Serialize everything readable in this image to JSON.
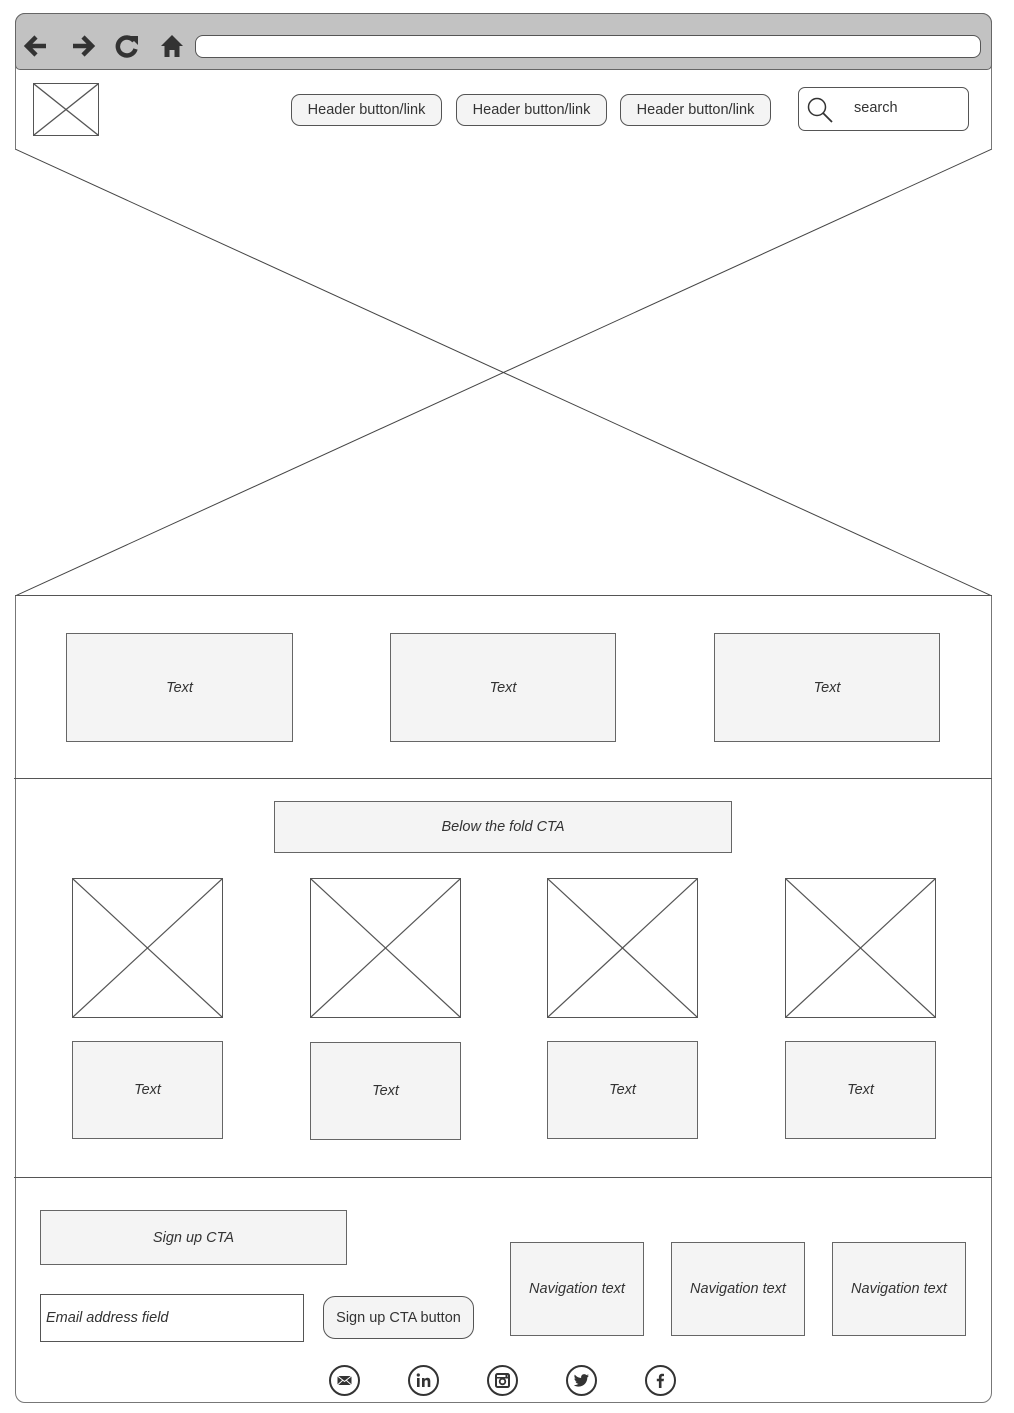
{
  "browser": {
    "nav_icons": [
      "back-arrow-icon",
      "forward-arrow-icon",
      "reload-icon",
      "home-icon"
    ],
    "url": ""
  },
  "header": {
    "logo": "image-placeholder",
    "buttons": [
      {
        "label": "Header button/link"
      },
      {
        "label": "Header button/link"
      },
      {
        "label": "Header button/link"
      }
    ],
    "search": {
      "icon": "search-icon",
      "placeholder": "search"
    }
  },
  "hero": {
    "image": "image-placeholder"
  },
  "features": [
    {
      "label": "Text"
    },
    {
      "label": "Text"
    },
    {
      "label": "Text"
    }
  ],
  "below_fold": {
    "cta_label": "Below the fold CTA",
    "cards": [
      {
        "image": "image-placeholder",
        "label": "Text"
      },
      {
        "image": "image-placeholder",
        "label": "Text"
      },
      {
        "image": "image-placeholder",
        "label": "Text"
      },
      {
        "image": "image-placeholder",
        "label": "Text"
      }
    ]
  },
  "footer": {
    "signup_cta_label": "Sign up CTA",
    "email_placeholder": "Email address field",
    "signup_button_label": "Sign up CTA button",
    "nav": [
      {
        "label": "Navigation text"
      },
      {
        "label": "Navigation text"
      },
      {
        "label": "Navigation text"
      }
    ],
    "social_icons": [
      "email-icon",
      "linkedin-icon",
      "instagram-icon",
      "twitter-icon",
      "facebook-icon"
    ]
  },
  "colors": {
    "chrome_bg": "#c2c2c2",
    "box_fill": "#f4f4f4",
    "stroke": "#555555",
    "text": "#333333"
  }
}
